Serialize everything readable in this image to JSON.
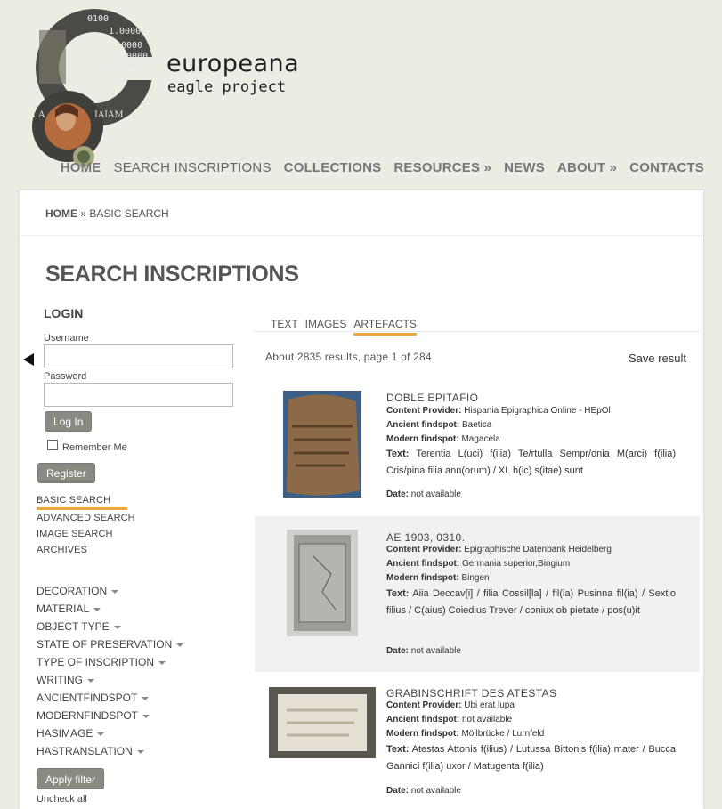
{
  "brand": {
    "name": "europeana",
    "subtitle": "eagle project"
  },
  "topnav": [
    {
      "label": "HOME"
    },
    {
      "label": "SEARCH INSCRIPTIONS"
    },
    {
      "label": "COLLECTIONS"
    },
    {
      "label": "RESOURCES »"
    },
    {
      "label": "NEWS"
    },
    {
      "label": "ABOUT »"
    },
    {
      "label": "CONTACTS"
    }
  ],
  "breadcrumb": {
    "home": "HOME",
    "sep": " » ",
    "current": "BASIC SEARCH"
  },
  "page_title": "SEARCH INSCRIPTIONS",
  "login": {
    "title": "LOGIN",
    "username_label": "Username",
    "username_value": "",
    "password_label": "Password",
    "password_value": "",
    "login_button": "Log In",
    "remember_label": "Remember Me",
    "register_button": "Register"
  },
  "search_links": [
    {
      "label": "BASIC SEARCH"
    },
    {
      "label": "ADVANCED SEARCH"
    },
    {
      "label": "IMAGE SEARCH"
    },
    {
      "label": "ARCHIVES"
    }
  ],
  "facets": [
    {
      "label": "DECORATION"
    },
    {
      "label": "MATERIAL"
    },
    {
      "label": "OBJECT TYPE"
    },
    {
      "label": "STATE OF PRESERVATION"
    },
    {
      "label": "TYPE OF INSCRIPTION"
    },
    {
      "label": "WRITING"
    },
    {
      "label": "ANCIENTFINDSPOT"
    },
    {
      "label": "MODERNFINDSPOT"
    },
    {
      "label": "HASIMAGE"
    },
    {
      "label": "HASTRANSLATION"
    }
  ],
  "apply_filter": "Apply filter",
  "uncheck_all": "Uncheck all",
  "tabs": [
    {
      "label": "TEXT"
    },
    {
      "label": "IMAGES"
    },
    {
      "label": "ARTEFACTS"
    }
  ],
  "result_count": "About 2835 results, page 1 of 284",
  "save_result": "Save result",
  "labels": {
    "content_provider": "Content Provider:",
    "ancient_findspot": "Ancient findspot:",
    "modern_findspot": "Modern findspot:",
    "text": "Text:",
    "date": "Date:"
  },
  "results": [
    {
      "title": "DOBLE EPITAFIO",
      "content_provider": "Hispania Epigraphica Online - HEpOl",
      "ancient_findspot": "Baetica",
      "modern_findspot": "Magacela",
      "text": "Terentia L(uci) f(ilia) Te/rtulla Sempr/onia M(arci) f(ilia) Cris/pina filia ann(orum) / XL h(ic) s(itae) sunt",
      "date": "not available"
    },
    {
      "title": "AE 1903, 0310.",
      "content_provider": "Epigraphische Datenbank Heidelberg",
      "ancient_findspot": "Germania superior,Bingium",
      "modern_findspot": "Bingen",
      "text": "Aiia Deccav[i] / filia Cossil[la] / fil(ia) Pusinna fil(ia) / Sextio filius / C(aius) Coiedius Trever / coniux ob pietate / pos(u)it",
      "date": "not available"
    },
    {
      "title": "GRABINSCHRIFT DES ATESTAS",
      "content_provider": "Ubi erat lupa",
      "ancient_findspot": "not available",
      "modern_findspot": "Möllbrücke / Lurnfeld",
      "text": "Atestas Attonis f(ilius) / Lutussa Bittonis f(ilia) mater / Bucca Gannici f(ilia) uxor / Matugenta f(ilia)",
      "date": "not available"
    }
  ],
  "colors": {
    "accent": "#f0a63c",
    "button": "#8a8a82",
    "background": "#ecebe4"
  }
}
